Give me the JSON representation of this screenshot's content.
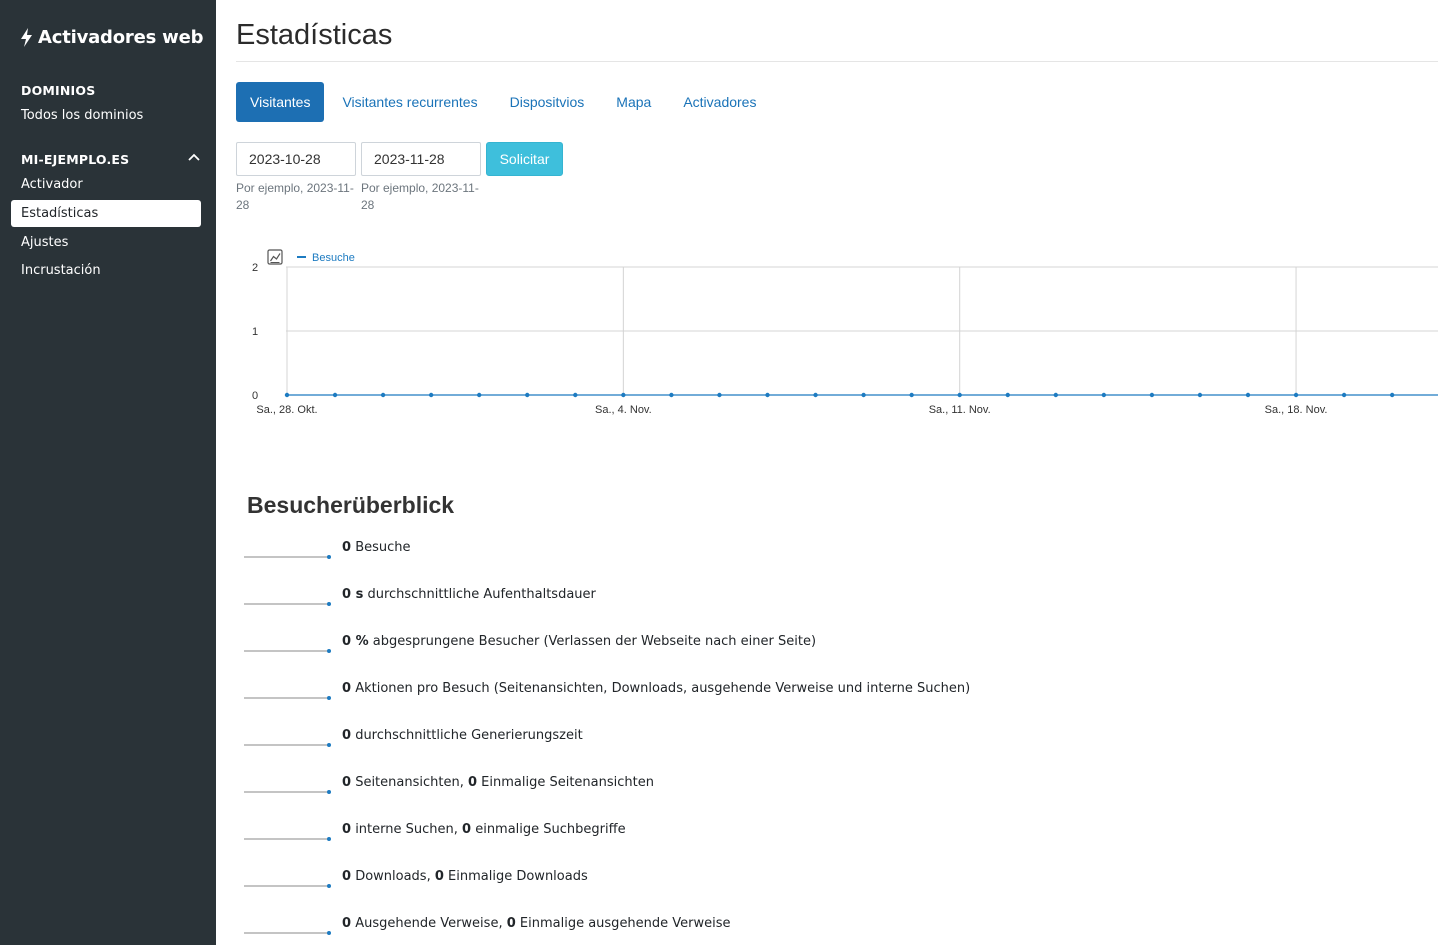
{
  "sidebar": {
    "brand": "Activadores web",
    "domains_title": "DOMINIOS",
    "all_domains": "Todos los dominios",
    "site_title": "MI-EJEMPLO.ES",
    "items": [
      "Activador",
      "Estadísticas",
      "Ajustes",
      "Incrustación"
    ],
    "active_item": "Estadísticas"
  },
  "header": {
    "title": "Estadísticas"
  },
  "tabs": [
    {
      "label": "Visitantes",
      "active": true
    },
    {
      "label": "Visitantes recurrentes",
      "active": false
    },
    {
      "label": "Dispositvios",
      "active": false
    },
    {
      "label": "Mapa",
      "active": false
    },
    {
      "label": "Activadores",
      "active": false
    }
  ],
  "date_range": {
    "from": "2023-10-28",
    "to": "2023-11-28",
    "from_hint": "Por ejemplo, 2023-11-28",
    "to_hint": "Por ejemplo, 2023-11-28",
    "submit_label": "Solicitar"
  },
  "chart_data": {
    "type": "line",
    "series": [
      {
        "name": "Besuche",
        "values": [
          0,
          0,
          0,
          0,
          0,
          0,
          0,
          0,
          0,
          0,
          0,
          0,
          0,
          0,
          0,
          0,
          0,
          0,
          0,
          0,
          0,
          0,
          0,
          0,
          0
        ]
      }
    ],
    "x_tick_labels": [
      "Sa., 28. Okt.",
      "Sa., 4. Nov.",
      "Sa., 11. Nov.",
      "Sa., 18. Nov."
    ],
    "y_ticks": [
      "0",
      "1",
      "2"
    ],
    "ylim": [
      0,
      2
    ],
    "grid": true,
    "legend_position": "top-left",
    "color": "#1d7bc1"
  },
  "overview": {
    "title": "Besucherüberblick",
    "metrics": [
      {
        "v1": "0",
        "u1": "",
        "t1": "Besuche",
        "v2": "",
        "t2": ""
      },
      {
        "v1": "0 s",
        "u1": "",
        "t1": "durchschnittliche Aufenthaltsdauer",
        "v2": "",
        "t2": ""
      },
      {
        "v1": "0 %",
        "u1": "",
        "t1": "abgesprungene Besucher (Verlassen der Webseite nach einer Seite)",
        "v2": "",
        "t2": ""
      },
      {
        "v1": "0",
        "u1": "",
        "t1": "Aktionen pro Besuch (Seitenansichten, Downloads, ausgehende Verweise und interne Suchen)",
        "v2": "",
        "t2": ""
      },
      {
        "v1": "0",
        "u1": "",
        "t1": "durchschnittliche Generierungszeit",
        "v2": "",
        "t2": ""
      },
      {
        "v1": "0",
        "u1": "",
        "t1": "Seitenansichten,",
        "v2": "0",
        "t2": "Einmalige Seitenansichten"
      },
      {
        "v1": "0",
        "u1": "",
        "t1": "interne Suchen,",
        "v2": "0",
        "t2": "einmalige Suchbegriffe"
      },
      {
        "v1": "0",
        "u1": "",
        "t1": "Downloads,",
        "v2": "0",
        "t2": "Einmalige Downloads"
      },
      {
        "v1": "0",
        "u1": "",
        "t1": "Ausgehende Verweise,",
        "v2": "0",
        "t2": "Einmalige ausgehende Verweise"
      }
    ]
  }
}
